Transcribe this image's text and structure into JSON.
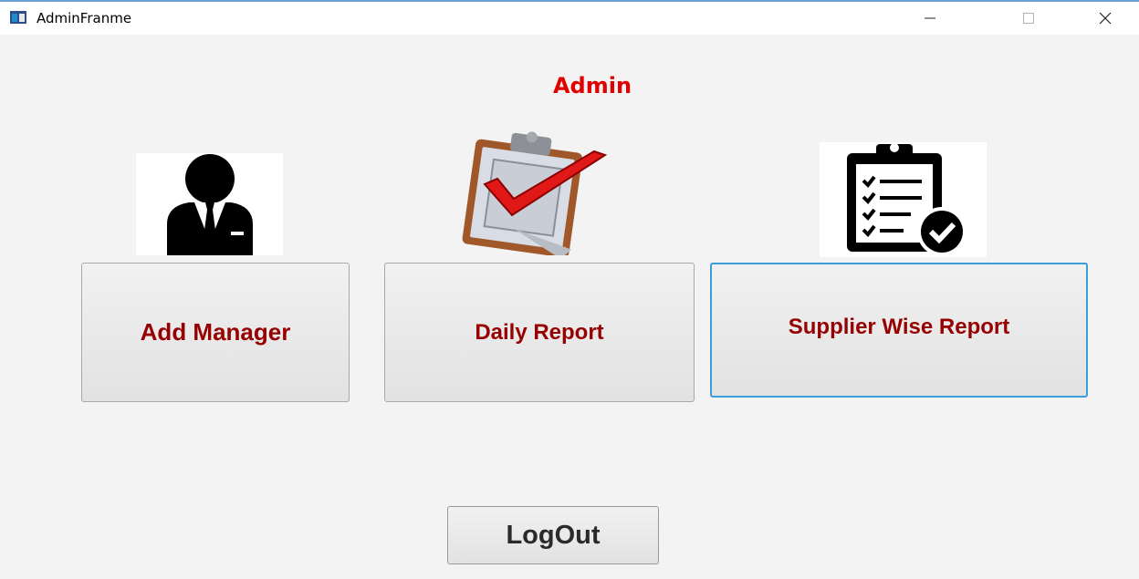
{
  "window": {
    "title": "AdminFranme",
    "controls": [
      "minimize",
      "maximize",
      "close"
    ]
  },
  "main": {
    "heading": "Admin",
    "buttons": {
      "add_manager": "Add Manager",
      "daily_report": "Daily Report",
      "supplier_wise_report": "Supplier Wise Report",
      "logout": "LogOut"
    },
    "icons": [
      "manager-icon",
      "clipboard-check-icon",
      "checklist-clipboard-icon"
    ]
  },
  "colors": {
    "heading": "#e00000",
    "button_text": "#960000",
    "logout_text": "#2a2a2a",
    "focus_border": "#3c9ddb"
  }
}
